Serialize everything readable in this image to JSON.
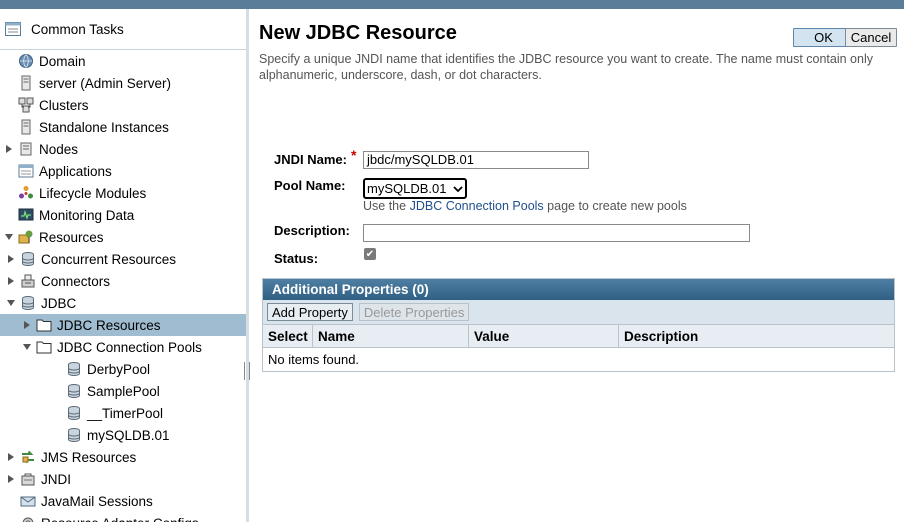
{
  "sidebar": {
    "header": "Common Tasks",
    "items": [
      {
        "label": "Domain",
        "icon": "globe-icon",
        "expander": ""
      },
      {
        "label": "server (Admin Server)",
        "icon": "server-icon",
        "expander": ""
      },
      {
        "label": "Clusters",
        "icon": "clusters-icon",
        "expander": ""
      },
      {
        "label": "Standalone Instances",
        "icon": "server-icon",
        "expander": ""
      },
      {
        "label": "Nodes",
        "icon": "nodes-icon",
        "expander": "collapsed"
      },
      {
        "label": "Applications",
        "icon": "applications-icon",
        "expander": ""
      },
      {
        "label": "Lifecycle Modules",
        "icon": "lifecycle-icon",
        "expander": ""
      },
      {
        "label": "Monitoring Data",
        "icon": "monitor-icon",
        "expander": ""
      },
      {
        "label": "Resources",
        "icon": "resources-icon",
        "expander": "expanded"
      },
      {
        "label": "Concurrent Resources",
        "icon": "database-icon",
        "expander": "collapsed"
      },
      {
        "label": "Connectors",
        "icon": "connectors-icon",
        "expander": "collapsed"
      },
      {
        "label": "JDBC",
        "icon": "database-icon",
        "expander": "expanded"
      },
      {
        "label": "JDBC Resources",
        "icon": "folder-icon",
        "expander": "collapsed"
      },
      {
        "label": "JDBC Connection Pools",
        "icon": "folder-icon",
        "expander": "expanded"
      },
      {
        "label": "DerbyPool",
        "icon": "database-icon",
        "expander": ""
      },
      {
        "label": "SamplePool",
        "icon": "database-icon",
        "expander": ""
      },
      {
        "label": "__TimerPool",
        "icon": "database-icon",
        "expander": ""
      },
      {
        "label": "mySQLDB.01",
        "icon": "database-icon",
        "expander": ""
      },
      {
        "label": "JMS Resources",
        "icon": "jms-icon",
        "expander": "collapsed"
      },
      {
        "label": "JNDI",
        "icon": "jndi-icon",
        "expander": "collapsed"
      },
      {
        "label": "JavaMail Sessions",
        "icon": "mail-icon",
        "expander": ""
      },
      {
        "label": "Resource Adapter Configs",
        "icon": "adapter-icon",
        "expander": ""
      }
    ]
  },
  "main": {
    "title": "New JDBC Resource",
    "help": "Specify a unique JNDI name that identifies the JDBC resource you want to create. The name must contain only alphanumeric, underscore, dash, or dot characters.",
    "ok_label": "OK",
    "cancel_label": "Cancel",
    "form": {
      "jndi_label": "JNDI Name:",
      "required_mark": "*",
      "jndi_value": "jbdc/mySQLDB.01",
      "pool_label": "Pool Name:",
      "pool_value": "mySQLDB.01",
      "pool_help_prefix": "Use the",
      "pool_help_link": "JDBC Connection Pools",
      "pool_help_suffix": "page to create new pools",
      "description_label": "Description:",
      "description_value": "",
      "status_label": "Status:",
      "status_checked": true
    },
    "properties": {
      "title": "Additional Properties (0)",
      "add_label": "Add Property",
      "delete_label": "Delete Properties",
      "columns": [
        "Select",
        "Name",
        "Value",
        "Description"
      ],
      "empty_text": "No items found."
    }
  },
  "colors": {
    "topbar": "#5a7d99",
    "selected_row": "#a0bcd0",
    "table_title": "#3d6e92",
    "required": "#cc0000",
    "link": "#1f4e8c"
  }
}
